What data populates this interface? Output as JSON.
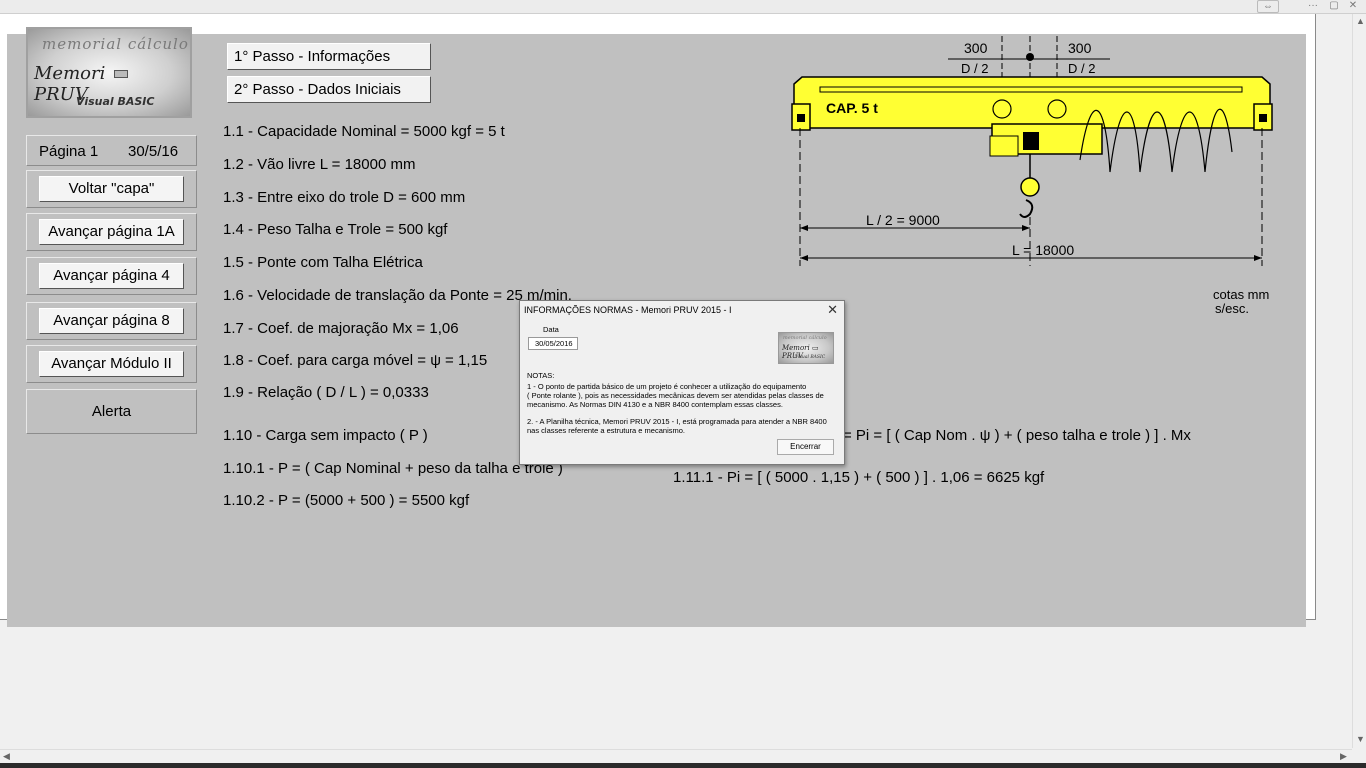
{
  "window": {
    "top_icons": [
      "resize-icon",
      "more-icon",
      "restore-icon",
      "close-icon"
    ]
  },
  "logo": {
    "line1": "memorial   cálculo",
    "line2": "Memori",
    "line2b": "PRUV",
    "line3": "Visual BASIC"
  },
  "sidebar": {
    "page_label": "Página 1",
    "page_date": "30/5/16",
    "buttons": [
      "Voltar  \"capa\"",
      "Avançar página 1A",
      "Avançar página 4",
      "Avançar página 8",
      "Avançar Módulo II"
    ],
    "alert_label": "Alerta"
  },
  "steps": {
    "step1": "1° Passo - Informações",
    "step2": "2° Passo  -  Dados Iniciais"
  },
  "lines": {
    "l1": "1.1 - Capacidade Nominal = 5000 kgf = 5 t",
    "l2": "1.2 - Vão livre   L = 18000 mm",
    "l3": "1.3 - Entre eixo do trole   D = 600 mm",
    "l4": "1.4 - Peso Talha e Trole = 500 kgf",
    "l5": "1.5 - Ponte com Talha Elétrica",
    "l6": "1.6 - Velocidade de translação da Ponte = 25 m/min.",
    "l7": "1.7 - Coef. de majoração  Mx = 1,06",
    "l8": "1.8 - Coef. para carga móvel = ψ  = 1,15",
    "l9": "1.9 - Relação ( D / L ) = 0,0333",
    "l10": "1.10 - Carga sem impacto ( P )",
    "l10_1": "1.10.1 - P = ( Cap Nominal + peso da talha e trole )",
    "l10_2": "1.10.2 - P = (5000 + 500 ) = 5500 kgf",
    "l11": "= Pi = [ ( Cap Nom . ψ ) + ( peso talha e trole ) ] . Mx",
    "l11_1": "1.11.1 - Pi = [ ( 5000 . 1,15 ) + ( 500 ) ] . 1,06 = 6625 kgf"
  },
  "drawing": {
    "dim_left": "300",
    "dim_right": "300",
    "d_half_left": "D / 2",
    "d_half_right": "D / 2",
    "cap": "CAP. 5 t",
    "l_half": "L / 2 = 9000",
    "l_full": "L = 18000",
    "cotas_1": "cotas mm",
    "cotas_2": "s/esc.",
    "beam_color": "#ffff33"
  },
  "dialog": {
    "title": "INFORMAÇÕES NORMAS - Memori PRUV 2015 - I",
    "date_label": "Data",
    "date_value": "30/05/2016",
    "notes_label": "NOTAS:",
    "note1_a": "1 - O ponto de partida básico de um projeto é conhecer a utilização do equipamento",
    "note1_b": "( Ponte rolante ), pois as necessidades mecânicas devem ser atendidas pelas classes de",
    "note1_c": "mecanismo. As Normas DIN 4130 e a NBR 8400 contemplam essas classes.",
    "note2_a": "2. - A Planilha técnica, Memori PRUV 2015 - I, está programada para atender a NBR 8400",
    "note2_b": "nas classes referente a estrutura e mecanismo.",
    "close_button": "Encerrar",
    "mini_logo_1": "memorial  cálculo",
    "mini_logo_2": "Memori ▭ PRUV",
    "mini_logo_3": "Visual BASIC"
  }
}
